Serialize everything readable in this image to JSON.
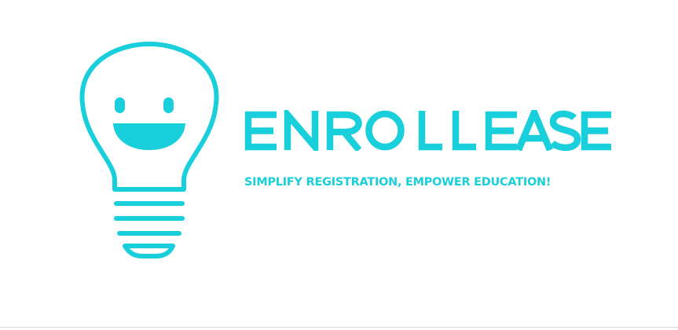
{
  "brand": {
    "name": "ENROLLEASE",
    "tagline": "SIMPLIFY REGISTRATION, EMPOWER EDUCATION!",
    "icon": "smiling-lightbulb-icon",
    "colors": {
      "accent": "#18cfdb",
      "background": "#ffffff",
      "divider": "#d9d9d9"
    }
  }
}
